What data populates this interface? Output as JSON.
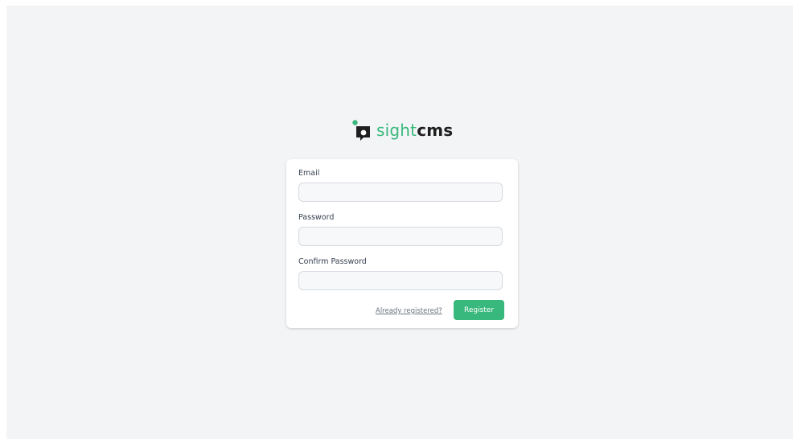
{
  "brand": {
    "name_part1": "sight",
    "name_part2": "cms",
    "accent_color": "#38b87c",
    "icon": "speech-bubble-logo-icon"
  },
  "form": {
    "email": {
      "label": "Email",
      "value": "",
      "placeholder": ""
    },
    "password": {
      "label": "Password",
      "value": "",
      "placeholder": ""
    },
    "confirm_password": {
      "label": "Confirm Password",
      "value": "",
      "placeholder": ""
    },
    "already_registered_link": "Already registered?",
    "register_button": "Register"
  }
}
